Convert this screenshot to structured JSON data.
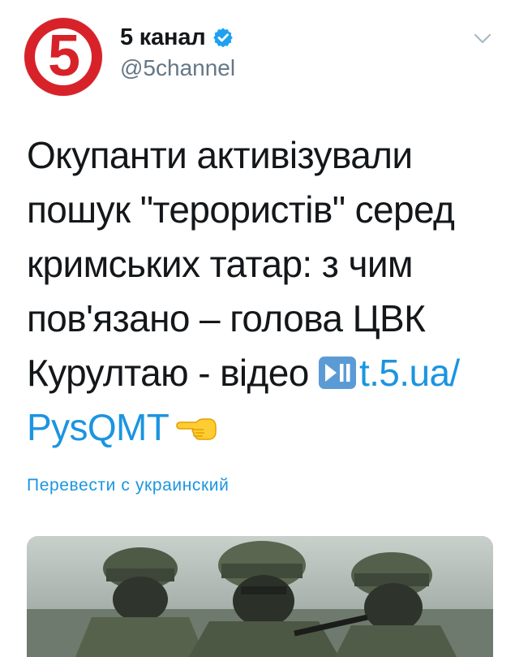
{
  "user": {
    "avatar_text": "5",
    "name": "5 канал",
    "handle": "@5channel",
    "verified": true
  },
  "tweet": {
    "text_before": "Окупанти активізували пошук \"терористів\" серед кримських татар: з чим пов'язано – голова ЦВК Курултаю - відео ",
    "media_icon": "play-pause-button-emoji",
    "link": "t.5.ua/ PysQMT",
    "trailing_icon": "backhand-index-pointing-left-emoji"
  },
  "translate_label": "Перевести с украинский",
  "media": {
    "description_icon": "photo-soldiers"
  },
  "colors": {
    "link": "#1b95e0",
    "brand_red": "#d8222a",
    "muted": "#657786",
    "text": "#14171a"
  }
}
